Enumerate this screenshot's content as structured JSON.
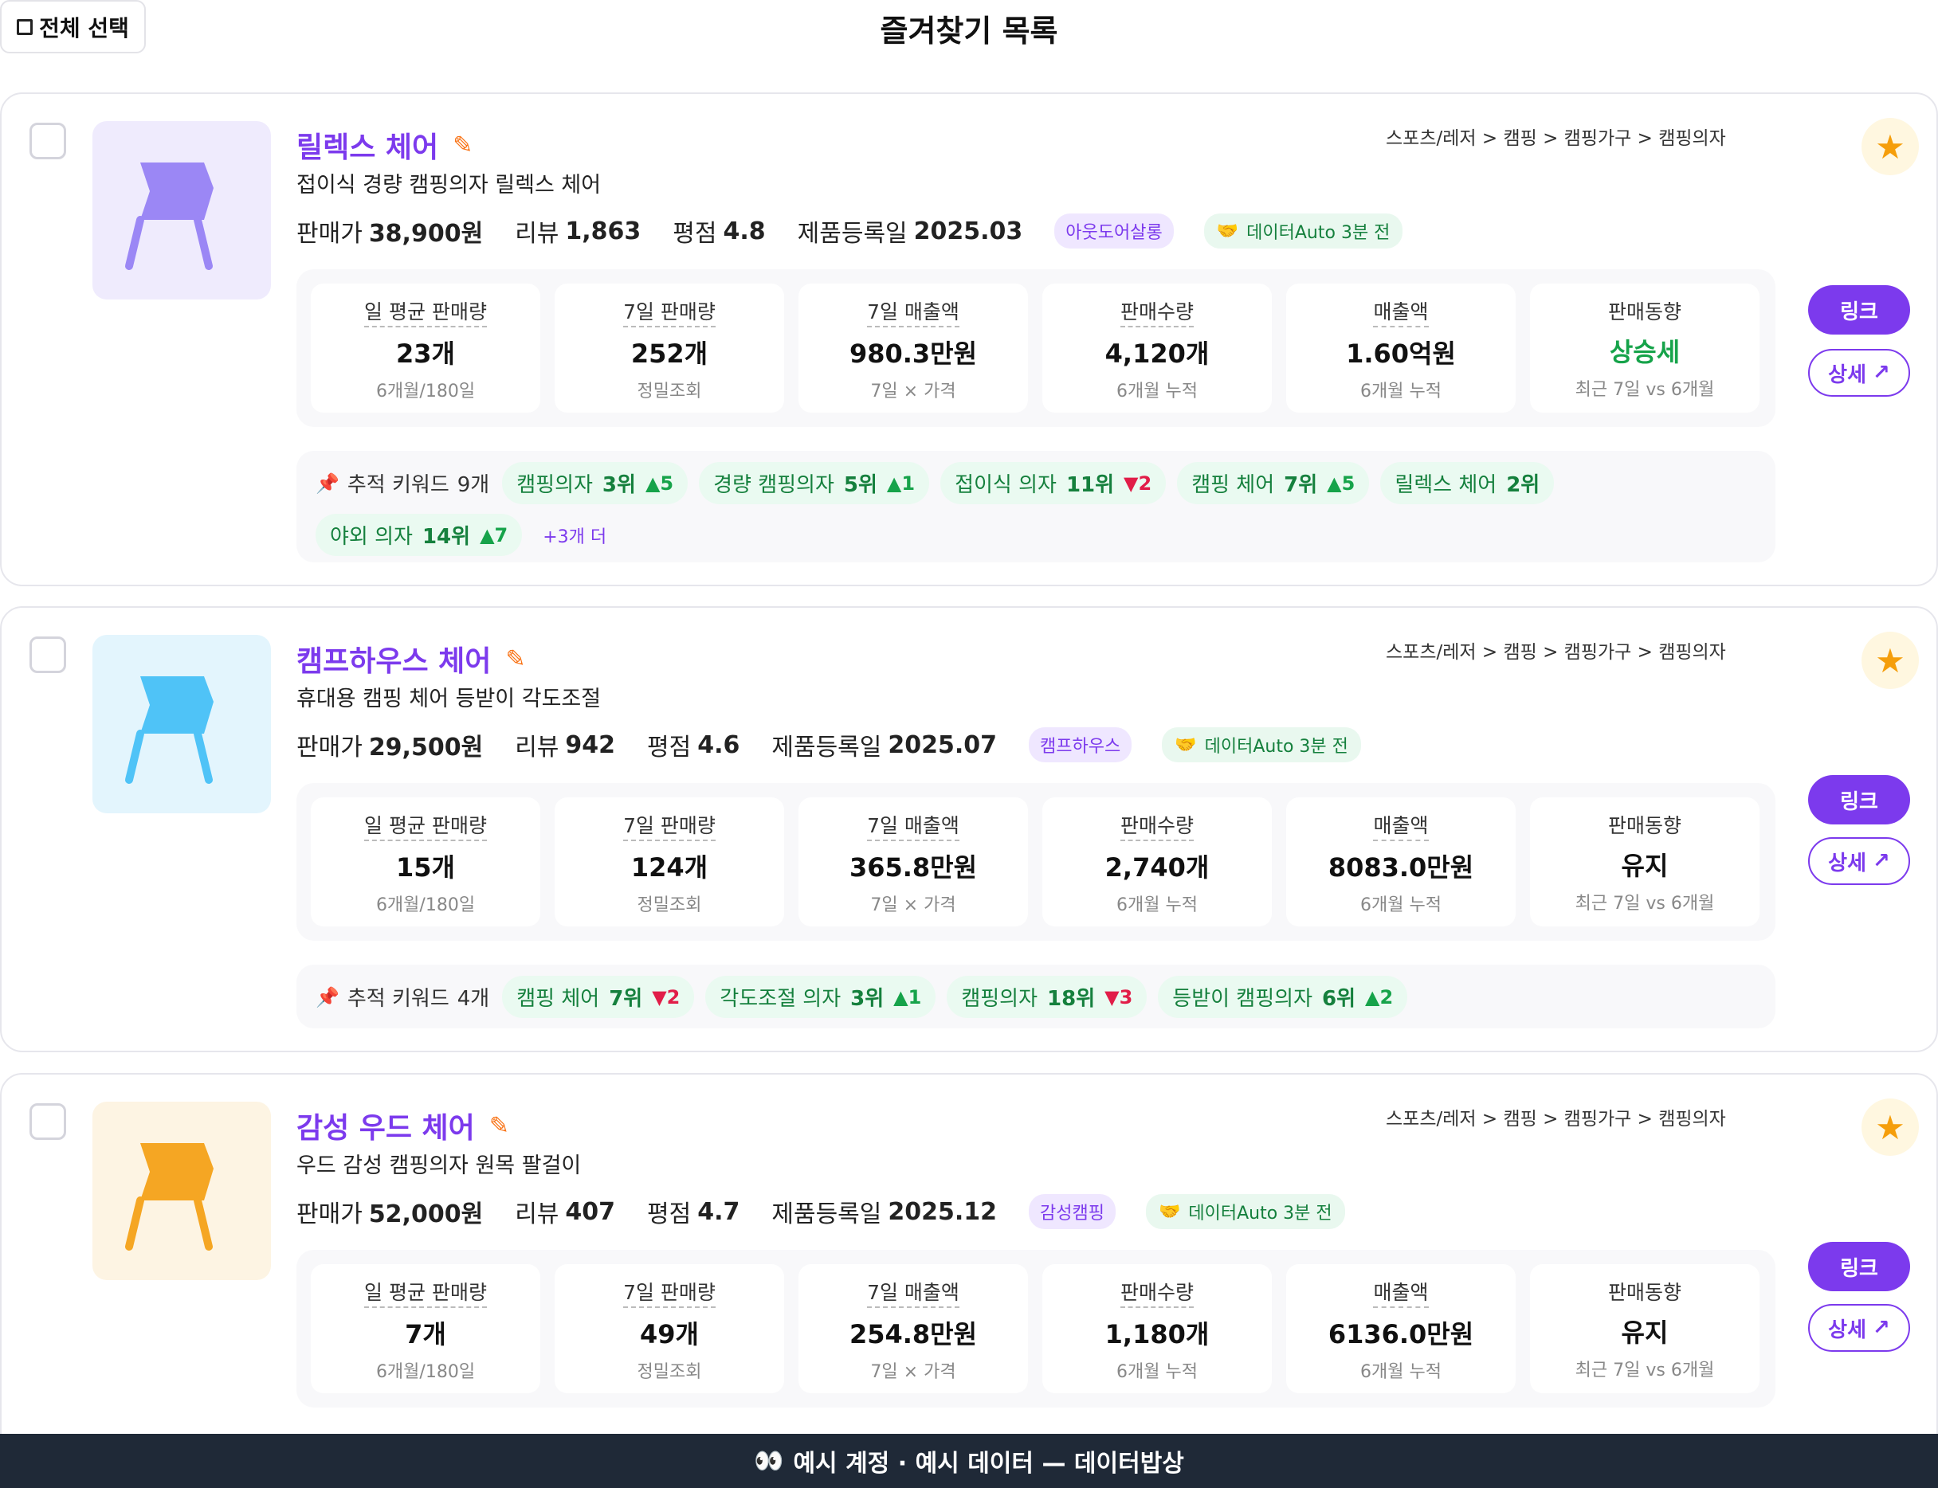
{
  "header": {
    "select_all": "전체 선택",
    "title": "즐겨찾기 목록"
  },
  "labels": {
    "price": "판매가",
    "review": "리뷰",
    "rating": "평점",
    "registered": "제품등록일",
    "link": "링크",
    "detail": "상세",
    "tracked_prefix": "추적 키워드"
  },
  "cards": [
    {
      "name": "릴렉스 체어",
      "desc": "접이식 경량 캠핑의자 릴렉스 체어",
      "category": "스포츠/레저 > 캠핑 > 캠핑가구 > 캠핑의자",
      "price": "38,900원",
      "review": "1,863",
      "rating": "4.8",
      "registered": "2025.03",
      "seller": "아웃도어살롱",
      "auto": "데이터Auto 3분 전",
      "color": "#9b87f5",
      "bg": "#efebfd",
      "stats": [
        {
          "label": "일 평균 판매량",
          "value": "23개",
          "sub": "6개월/180일"
        },
        {
          "label": "7일 판매량",
          "value": "252개",
          "sub": "정밀조회"
        },
        {
          "label": "7일 매출액",
          "value": "980.3만원",
          "sub": "7일 × 가격"
        },
        {
          "label": "판매수량",
          "value": "4,120개",
          "sub": "6개월 누적"
        },
        {
          "label": "매출액",
          "value": "1.60억원",
          "sub": "6개월 누적"
        },
        {
          "label": "판매동향",
          "value": "상승세",
          "sub": "최근 7일 vs 6개월"
        }
      ],
      "kw_count": "9개",
      "keywords": [
        {
          "kw": "캠핑의자",
          "rank": "3위",
          "delta": "▲5",
          "dir": "up"
        },
        {
          "kw": "경량 캠핑의자",
          "rank": "5위",
          "delta": "▲1",
          "dir": "up"
        },
        {
          "kw": "접이식 의자",
          "rank": "11위",
          "delta": "▼2",
          "dir": "down"
        },
        {
          "kw": "캠핑 체어",
          "rank": "7위",
          "delta": "▲5",
          "dir": "up"
        },
        {
          "kw": "릴렉스 체어",
          "rank": "2위",
          "delta": "",
          "dir": "none"
        },
        {
          "kw": "야외 의자",
          "rank": "14위",
          "delta": "▲7",
          "dir": "up"
        }
      ],
      "more": "+3개 더"
    },
    {
      "name": "캠프하우스 체어",
      "desc": "휴대용 캠핑 체어 등받이 각도조절",
      "category": "스포츠/레저 > 캠핑 > 캠핑가구 > 캠핑의자",
      "price": "29,500원",
      "review": "942",
      "rating": "4.6",
      "registered": "2025.07",
      "seller": "캠프하우스",
      "auto": "데이터Auto 3분 전",
      "color": "#4fc3f7",
      "bg": "#e3f5fd",
      "stats": [
        {
          "label": "일 평균 판매량",
          "value": "15개",
          "sub": "6개월/180일"
        },
        {
          "label": "7일 판매량",
          "value": "124개",
          "sub": "정밀조회"
        },
        {
          "label": "7일 매출액",
          "value": "365.8만원",
          "sub": "7일 × 가격"
        },
        {
          "label": "판매수량",
          "value": "2,740개",
          "sub": "6개월 누적"
        },
        {
          "label": "매출액",
          "value": "8083.0만원",
          "sub": "6개월 누적"
        },
        {
          "label": "판매동향",
          "value": "유지",
          "sub": "최근 7일 vs 6개월"
        }
      ],
      "kw_count": "4개",
      "keywords": [
        {
          "kw": "캠핑 체어",
          "rank": "7위",
          "delta": "▼2",
          "dir": "down"
        },
        {
          "kw": "각도조절 의자",
          "rank": "3위",
          "delta": "▲1",
          "dir": "up"
        },
        {
          "kw": "캠핑의자",
          "rank": "18위",
          "delta": "▼3",
          "dir": "down"
        },
        {
          "kw": "등받이 캠핑의자",
          "rank": "6위",
          "delta": "▲2",
          "dir": "up"
        }
      ],
      "more": ""
    },
    {
      "name": "감성 우드 체어",
      "desc": "우드 감성 캠핑의자 원목 팔걸이",
      "category": "스포츠/레저 > 캠핑 > 캠핑가구 > 캠핑의자",
      "price": "52,000원",
      "review": "407",
      "rating": "4.7",
      "registered": "2025.12",
      "seller": "감성캠핑",
      "auto": "데이터Auto 3분 전",
      "color": "#f5a623",
      "bg": "#fdf4e3",
      "stats": [
        {
          "label": "일 평균 판매량",
          "value": "7개",
          "sub": "6개월/180일"
        },
        {
          "label": "7일 판매량",
          "value": "49개",
          "sub": "정밀조회"
        },
        {
          "label": "7일 매출액",
          "value": "254.8만원",
          "sub": "7일 × 가격"
        },
        {
          "label": "판매수량",
          "value": "1,180개",
          "sub": "6개월 누적"
        },
        {
          "label": "매출액",
          "value": "6136.0만원",
          "sub": "6개월 누적"
        },
        {
          "label": "판매동향",
          "value": "유지",
          "sub": "최근 7일 vs 6개월"
        }
      ],
      "kw_count": "",
      "keywords": [],
      "more": ""
    }
  ],
  "footer": {
    "text": "예시 계정 · 예시 데이터 — 데이터밥상"
  }
}
